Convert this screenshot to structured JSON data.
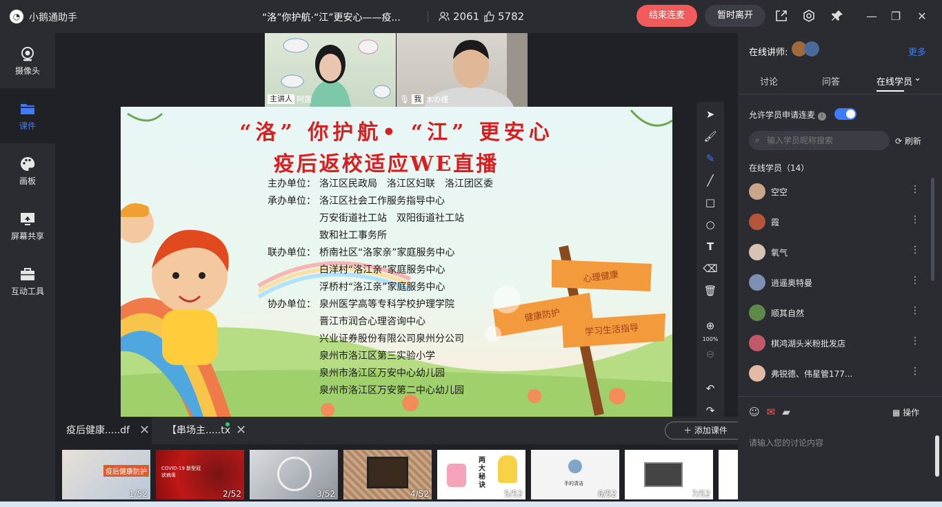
{
  "app": {
    "name": "小鹅通助手"
  },
  "room": {
    "title": "“洛”你护航·“江”更安心——疫..."
  },
  "stats": {
    "viewers": "2061",
    "likes": "5782"
  },
  "header_buttons": {
    "end_mic": "结束连麦",
    "leave": "暂时离开"
  },
  "sidebar": {
    "items": [
      {
        "label": "摄像头"
      },
      {
        "label": "课件"
      },
      {
        "label": "画板"
      },
      {
        "label": "屏幕共享"
      },
      {
        "label": "互动工具"
      }
    ]
  },
  "videos": [
    {
      "role_tag": "主讲人",
      "name": "阿莲"
    },
    {
      "role_tag": "我",
      "name": "木の槿"
    }
  ],
  "slide": {
    "title1": "“洛” 你护航• “江” 更安心",
    "title2": "疫后返校适应WE直播",
    "signs": [
      "心理健康",
      "健康防护",
      "学习生活指导"
    ],
    "lines": [
      {
        "label": "主办单位：",
        "text": "洛江区民政局　洛江区妇联　洛江团区委"
      },
      {
        "label": "承办单位：",
        "text": "洛江区社会工作服务指导中心"
      },
      {
        "label": "",
        "text": "万安街道社工站　双阳街道社工站"
      },
      {
        "label": "",
        "text": "致和社工事务所"
      },
      {
        "label": "联办单位：",
        "text": "桥南社区“洛家亲”家庭服务中心"
      },
      {
        "label": "",
        "text": "白洋村“洛江亲”家庭服务中心"
      },
      {
        "label": "",
        "text": "浮桥村“洛江亲”家庭服务中心"
      },
      {
        "label": "协办单位：",
        "text": "泉州医学高等专科学校护理学院"
      },
      {
        "label": "",
        "text": "晋江市润合心理咨询中心"
      },
      {
        "label": "",
        "text": "兴业证券股份有限公司泉州分公司"
      },
      {
        "label": "",
        "text": "泉州市洛江区第三实验小学"
      },
      {
        "label": "",
        "text": "泉州市洛江区万安中心幼儿园"
      },
      {
        "label": "",
        "text": "泉州市洛江区万安第二中心幼儿园"
      }
    ]
  },
  "toolbar": {
    "zoom": "100%"
  },
  "file_tabs": [
    {
      "name": "疫后健康.....df"
    },
    {
      "name": "【串场主.....tx"
    }
  ],
  "add_course": "添加课件",
  "thumbnails": [
    {
      "num": "1/52",
      "caption": "疫后健康防护"
    },
    {
      "num": "2/52",
      "caption": "COVID-19 新型冠状病毒"
    },
    {
      "num": "3/52",
      "caption": ""
    },
    {
      "num": "4/52",
      "caption": ""
    },
    {
      "num": "5/52",
      "caption": "两大秘诀"
    },
    {
      "num": "6/52",
      "caption": "手的清洁"
    },
    {
      "num": "7/52",
      "caption": ""
    }
  ],
  "right_panel": {
    "title": "在线讲师:",
    "more": "更多",
    "tabs": [
      "讨论",
      "问答",
      "在线学员"
    ],
    "allow_label": "允许学员申请连麦",
    "search_placeholder": "输入学员昵称搜索",
    "refresh": "刷新",
    "online_count": "在线学员（14）",
    "members": [
      {
        "name": "空空",
        "color": "#c9a58a"
      },
      {
        "name": "霞",
        "color": "#b5553a"
      },
      {
        "name": "氧气",
        "color": "#d8c2b4"
      },
      {
        "name": "逍遥奥特曼",
        "color": "#7f8fb3"
      },
      {
        "name": "顺其自然",
        "color": "#5d8a4a"
      },
      {
        "name": "棋鸿湖头米粉批发店",
        "color": "#c05a6a"
      },
      {
        "name": "弗锐德、伟星管177...",
        "color": "#e2b9a3"
      }
    ],
    "operate": "操作",
    "chat_placeholder": "请输入您的讨论内容"
  }
}
